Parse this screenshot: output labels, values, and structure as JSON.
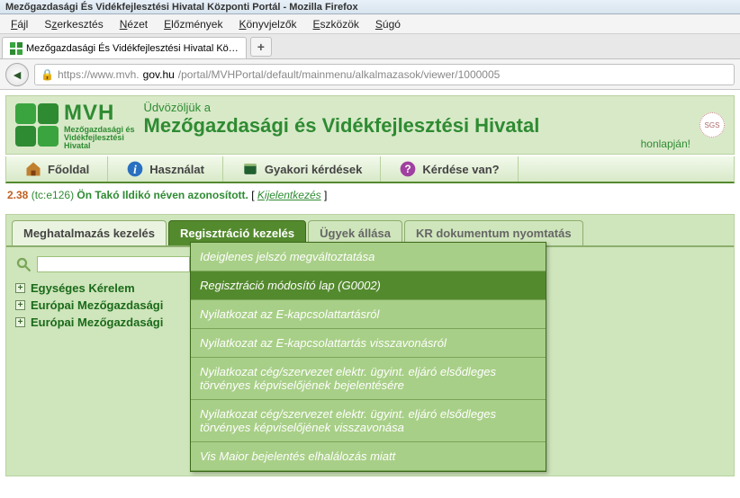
{
  "window": {
    "title": "Mezőgazdasági És Vidékfejlesztési Hivatal Központi Portál - Mozilla Firefox"
  },
  "browser": {
    "menus": [
      "Fájl",
      "Szerkesztés",
      "Nézet",
      "Előzmények",
      "Könyvjelzők",
      "Eszközök",
      "Súgó"
    ],
    "tab_title": "Mezőgazdasági És Vidékfejlesztési Hivatal Kö…",
    "newtab": "+",
    "url_pre": "https://www.mvh.",
    "url_host": "gov.hu",
    "url_rest": "/portal/MVHPortal/default/mainmenu/alkalmazasok/viewer/1000005"
  },
  "logo": {
    "text": "MVH",
    "sub1": "Mezőgazdasági és",
    "sub2": "Vidékfejlesztési",
    "sub3": "Hivatal"
  },
  "greeting": {
    "line1": "Üdvözöljük a",
    "line2": "Mezőgazdasági és Vidékfejlesztési Hivatal",
    "line3": "honlapján!",
    "sgs": "SGS"
  },
  "mainnav": {
    "items": [
      {
        "label": "Főoldal",
        "icon": "home"
      },
      {
        "label": "Használat",
        "icon": "info"
      },
      {
        "label": "Gyakori kérdések",
        "icon": "book"
      },
      {
        "label": "Kérdése van?",
        "icon": "question"
      }
    ]
  },
  "status": {
    "version": "2.38",
    "tc": "(tc:e126)",
    "prefix": "Ön ",
    "user": "Takó Ildikó",
    "suffix": " néven azonosított.",
    "open": " [ ",
    "logout": "Kijelentkezés",
    "close": " ]"
  },
  "tabs": [
    {
      "label": "Meghatalmazás kezelés",
      "state": "normal"
    },
    {
      "label": "Regisztráció kezelés",
      "state": "active"
    },
    {
      "label": "Ügyek állása",
      "state": "inactive"
    },
    {
      "label": "KR dokumentum nyomtatás",
      "state": "inactive"
    }
  ],
  "dropdown": [
    {
      "label": "Ideiglenes jelszó megváltoztatása",
      "sel": false
    },
    {
      "label": "Regisztráció módosító lap (G0002)",
      "sel": true
    },
    {
      "label": "Nyilatkozat az E-kapcsolattartásról",
      "sel": false
    },
    {
      "label": "Nyilatkozat az E-kapcsolattartás visszavonásról",
      "sel": false
    },
    {
      "label": "Nyilatkozat cég/szervezet elektr. ügyint. eljáró elsődleges törvényes képviselőjének bejelentésére",
      "sel": false
    },
    {
      "label": "Nyilatkozat cég/szervezet elektr. ügyint. eljáró elsődleges törvényes képviselőjének visszavonása",
      "sel": false
    },
    {
      "label": "Vis Maior bejelentés elhalálozás miatt",
      "sel": false
    }
  ],
  "tree": [
    "Egységes Kérelem",
    "Európai Mezőgazdasági",
    "Európai Mezőgazdasági"
  ]
}
